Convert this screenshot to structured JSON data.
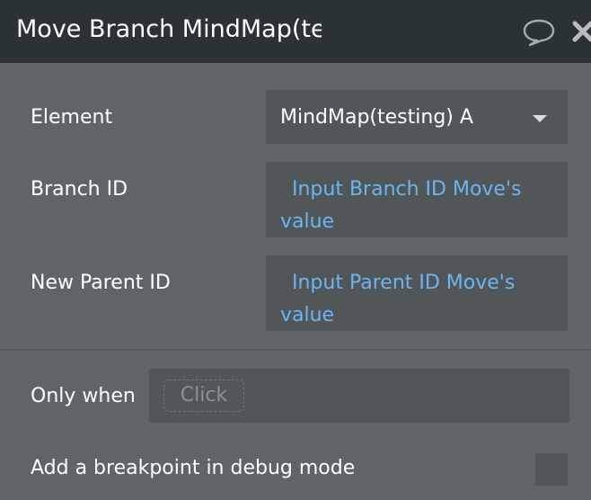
{
  "header": {
    "title": "Move Branch MindMap(te",
    "comment_icon": "speech-bubble-icon",
    "close_icon": "close-x-icon"
  },
  "fields": {
    "element": {
      "label": "Element",
      "value": "MindMap(testing) A"
    },
    "branch_id": {
      "label": "Branch ID",
      "value": "Input Branch ID Move's value"
    },
    "new_parent_id": {
      "label": "New Parent ID",
      "value": "Input Parent ID Move's value"
    }
  },
  "condition": {
    "label": "Only when",
    "placeholder": "Click"
  },
  "debug": {
    "label": "Add a breakpoint in debug mode",
    "checked": false
  },
  "colors": {
    "header_bg": "#2b3236",
    "panel_bg": "#5f6469",
    "field_bg": "#515659",
    "expression_text": "#6fb3f0"
  }
}
